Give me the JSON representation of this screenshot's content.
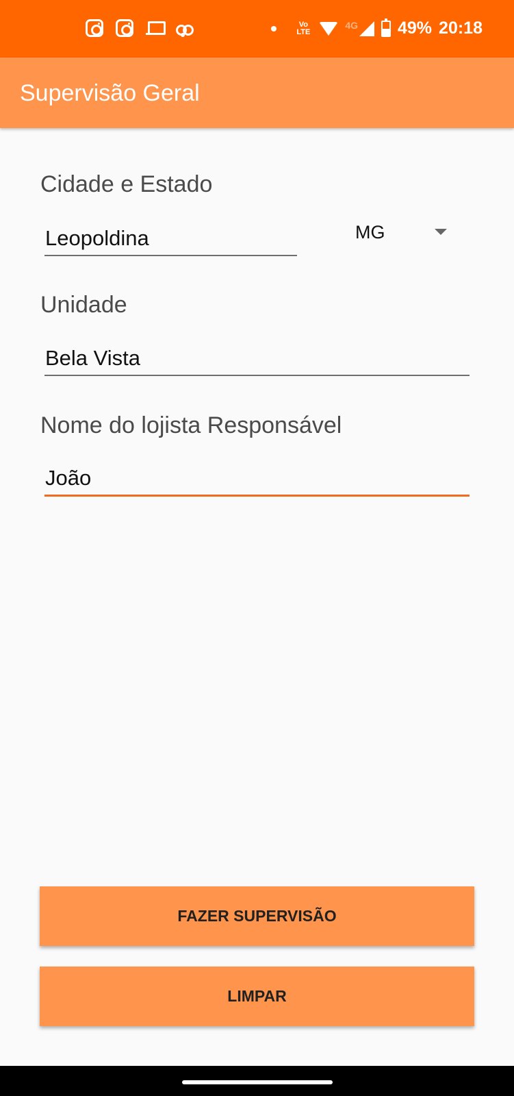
{
  "status_bar": {
    "left_icons": [
      "instagram-icon",
      "instagram-icon",
      "laptop-icon",
      "voicemail-icon"
    ],
    "volte": "Vo LTE",
    "network": "4G",
    "battery": "49%",
    "time": "20:18",
    "background": "#ff6600"
  },
  "toolbar": {
    "title": "Supervisão Geral",
    "background": "#ff944d"
  },
  "form": {
    "city_state_label": "Cidade e Estado",
    "city_value": "Leopoldina",
    "state_value": "MG",
    "unit_label": "Unidade",
    "unit_value": "Bela Vista",
    "responsible_label": "Nome do lojista Responsável",
    "responsible_value": "João"
  },
  "buttons": {
    "supervise": "FAZER SUPERVISÃO",
    "clear": "LIMPAR"
  },
  "colors": {
    "accent": "#f26a1b",
    "button": "#ff944d"
  }
}
